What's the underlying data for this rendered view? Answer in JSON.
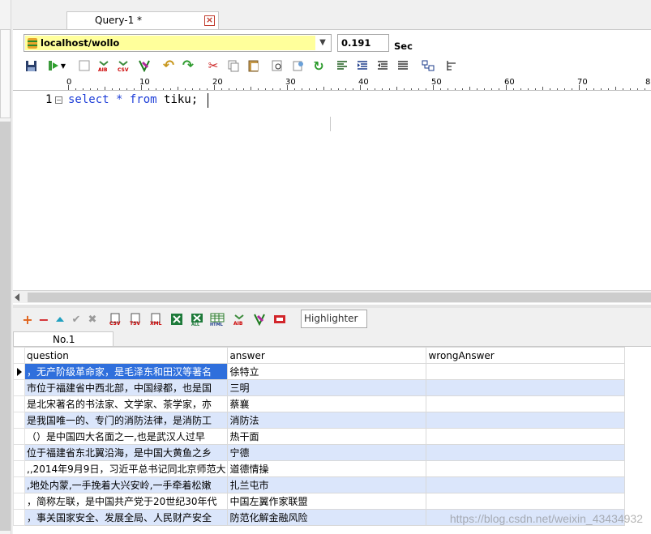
{
  "window": {
    "tab_title": "Query-1 *",
    "tab_close_glyph": "×"
  },
  "toolbar": {
    "connection": "localhost/wollo",
    "exec_time": "0.191",
    "exec_time_unit": "Sec"
  },
  "ruler": {
    "labels": [
      "0",
      "10",
      "20",
      "30",
      "40",
      "50",
      "60",
      "70",
      "8"
    ]
  },
  "editor": {
    "line_number": "1",
    "fold_glyph": "⊟",
    "tokens": [
      {
        "text": "select",
        "kind": "kw"
      },
      {
        "text": " * ",
        "kind": "kw"
      },
      {
        "text": "from",
        "kind": "kw"
      },
      {
        "text": " tiku;",
        "kind": "plain"
      }
    ]
  },
  "results": {
    "highlighter_value": "Highlighter",
    "tab_label": "No.1",
    "columns": [
      "question",
      "answer",
      "wrongAnswer"
    ],
    "rows": [
      [
        "，无产阶级革命家，是毛泽东和田汉等著名",
        "徐特立",
        ""
      ],
      [
        "市位于福建省中西北部，中国绿都，也是国",
        "三明",
        ""
      ],
      [
        "是北宋著名的书法家、文学家、茶学家，亦",
        "蔡襄",
        ""
      ],
      [
        "是我国唯一的、专门的消防法律，是消防工",
        "消防法",
        ""
      ],
      [
        "（）是中国四大名面之一,也是武汉人过早",
        "热干面",
        ""
      ],
      [
        "位于福建省东北翼沿海，是中国大黄鱼之乡",
        "宁德",
        ""
      ],
      [
        ",,2014年9月9日，习近平总书记同北京师范大",
        "道德情操",
        ""
      ],
      [
        ",地处内蒙,一手挽着大兴安岭,一手牵着松嫩",
        "扎兰屯市",
        ""
      ],
      [
        "，简称左联，是中国共产党于20世纪30年代",
        "中国左翼作家联盟",
        ""
      ],
      [
        "，事关国家安全、发展全局、人民财产安全",
        "防范化解金融风险",
        ""
      ]
    ]
  },
  "footer": {
    "watermark": "https://blog.csdn.net/weixin_43434932"
  },
  "colors": {
    "keyword": "#1f3fd8",
    "connection_bg": "#ffff9b",
    "selected_row": "#2f6fdc",
    "alt_row": "#dbe6fb"
  },
  "icons": {
    "top_toolbar": [
      "save-icon",
      "execute-icon",
      "dropdown-arrow-icon",
      "stop-icon",
      "blank-icon",
      "export-aib-icon",
      "export-csv-icon",
      "query-wizard-icon",
      "undo-icon",
      "redo-icon",
      "cut-icon",
      "copy-icon",
      "paste-icon",
      "find-icon",
      "replace-icon",
      "goto-icon",
      "align-left-icon",
      "indent-icon",
      "outdent-icon",
      "comment-icon",
      "format-icon",
      "schema-icon"
    ],
    "result_toolbar": [
      "add-row-icon",
      "delete-row-icon",
      "move-up-icon",
      "apply-icon",
      "cancel-icon",
      "export-csv-icon",
      "export-tsv-icon",
      "export-xml-icon",
      "export-excel-icon",
      "export-excel-all-icon",
      "export-html-icon",
      "export-aib-icon",
      "query-wizard-icon",
      "message-icon"
    ]
  }
}
